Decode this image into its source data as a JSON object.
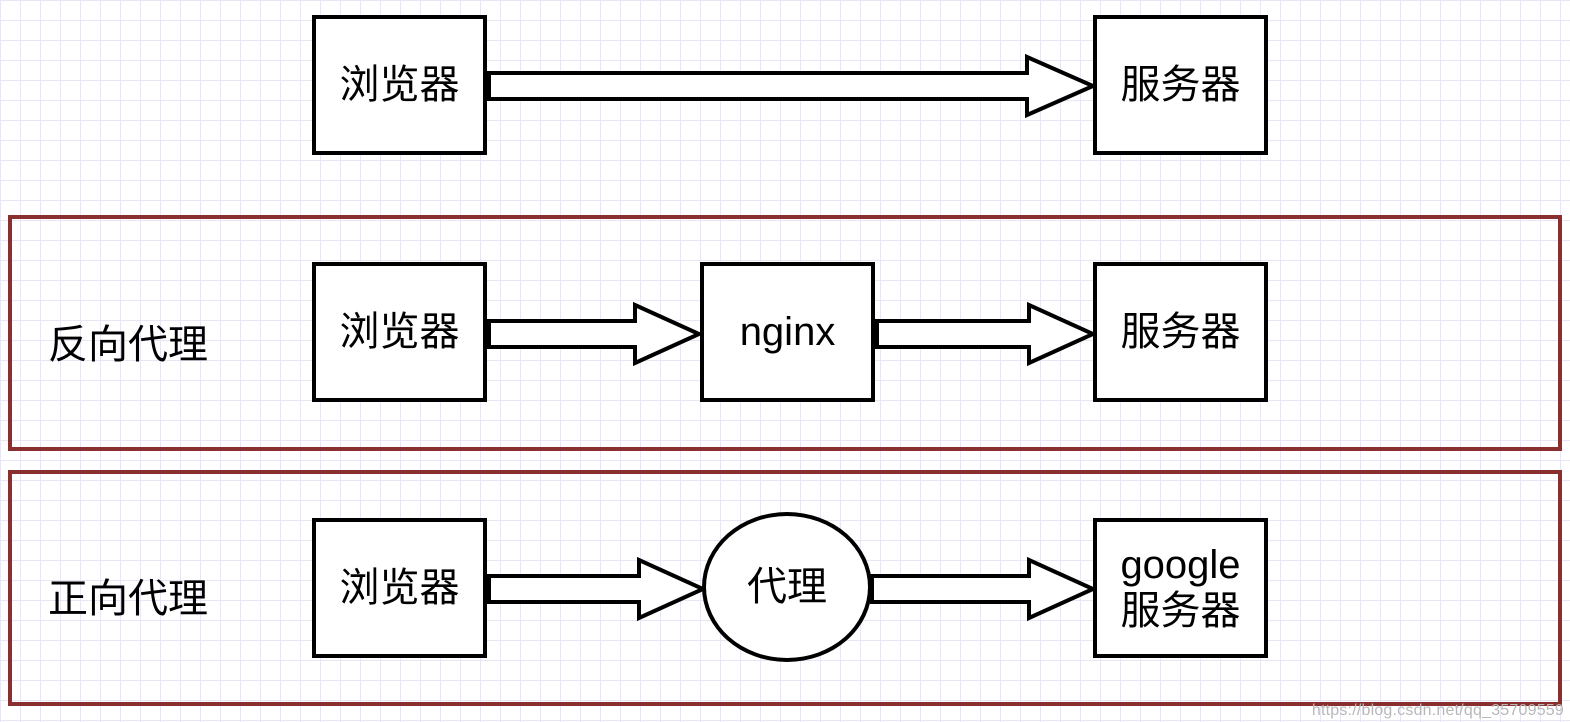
{
  "rows": {
    "direct": {
      "browser": "浏览器",
      "server": "服务器"
    },
    "reverse": {
      "label": "反向代理",
      "browser": "浏览器",
      "middle": "nginx",
      "server": "服务器"
    },
    "forward": {
      "label": "正向代理",
      "browser": "浏览器",
      "middle": "代理",
      "server": "google\n服务器"
    }
  },
  "watermark": "https://blog.csdn.net/qq_35709559"
}
